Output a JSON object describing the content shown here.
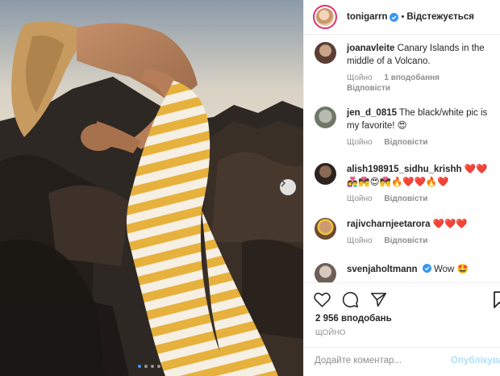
{
  "post": {
    "image_alt": "",
    "carousel_dots": 4,
    "active_dot": 0
  },
  "header": {
    "username": "tonigarrn",
    "separator": "•",
    "follow_label": "Відстежується"
  },
  "comments": [
    {
      "username": "joanavleite",
      "text": "Canary Islands in the middle of a Volcano.",
      "time": "Щойно",
      "likes": "1 вподобання",
      "reply": "Відповісти"
    },
    {
      "username": "jen_d_0815",
      "text": "The black/white pic is my favorite! 😍",
      "time": "Щойно",
      "reply": "Відповісти"
    },
    {
      "username": "alish198915_sidhu_krishh",
      "text": "❤️❤️ 👩‍❤️‍👨💏😍💏🔥❤️❤️🔥❤️",
      "time": "Щойно",
      "reply": "Відповісти"
    },
    {
      "username": "rajivcharnjeetarora",
      "text": "❤️❤️❤️",
      "time": "Щойно",
      "reply": "Відповісти"
    },
    {
      "username": "svenjaholtmann",
      "text": "Wow 🤩",
      "verified": true
    }
  ],
  "actions": {
    "likes_count": "2 956 вподобань",
    "time": "ЩОЙНО"
  },
  "add_comment": {
    "placeholder": "Додайте коментар...",
    "publish_label": "Опублікувати"
  },
  "colors": {
    "verified_blue": "#3897f0",
    "link_disabled": "#b2dffc",
    "muted_text": "#8e8e8e",
    "stripe_yellow": "#e6b13c"
  }
}
